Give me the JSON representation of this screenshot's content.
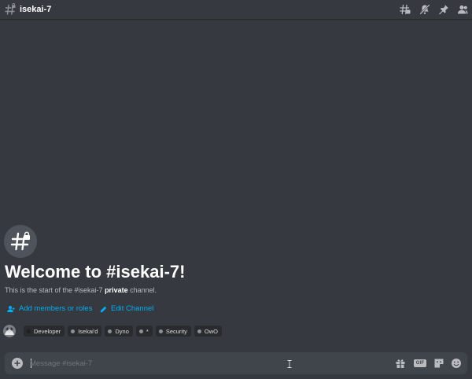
{
  "channel": {
    "name": "isekai-7"
  },
  "header_icons": [
    "threads-icon",
    "mute-icon",
    "pin-icon",
    "members-icon"
  ],
  "welcome": {
    "title": "Welcome to #isekai-7!",
    "subtitle_prefix": "This is the start of the #isekai-7 ",
    "subtitle_bold": "private",
    "subtitle_suffix": " channel."
  },
  "actions": {
    "add_members": "Add members or roles",
    "edit_channel": "Edit Channel"
  },
  "roles": [
    {
      "name": "Developer",
      "color": "#1e1f22"
    },
    {
      "name": "Isekai'd",
      "color": "#8e9297"
    },
    {
      "name": "Dyno",
      "color": "#8e9297"
    },
    {
      "name": "*",
      "color": "#8e9297"
    },
    {
      "name": "Security",
      "color": "#8e9297"
    },
    {
      "name": "OwO",
      "color": "#8e9297"
    }
  ],
  "composer": {
    "placeholder": "Message #isekai-7",
    "value": "",
    "gif_label": "GIF"
  },
  "colors": {
    "background": "#36393f",
    "link": "#00aff4",
    "input_bg": "#40444b",
    "pill_bg": "#292b2f"
  }
}
